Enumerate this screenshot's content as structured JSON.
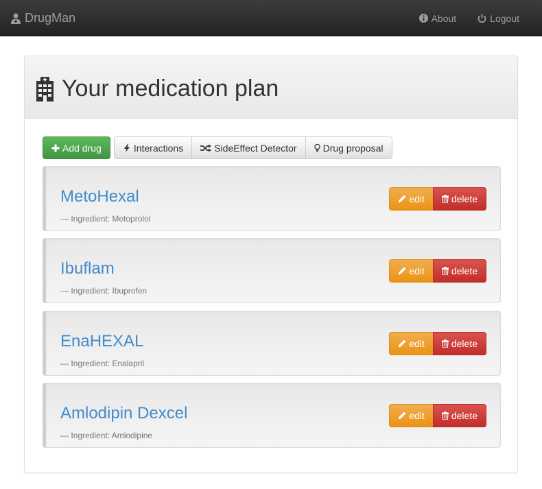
{
  "navbar": {
    "brand": "DrugMan",
    "brand_icon": "user-md-icon",
    "links": [
      {
        "label": "About",
        "icon": "info-sign-icon"
      },
      {
        "label": "Logout",
        "icon": "off-icon"
      }
    ]
  },
  "panel": {
    "title": "Your medication plan",
    "title_icon": "hospital-icon"
  },
  "toolbar": {
    "add_label": "Add drug",
    "interactions_label": "Interactions",
    "sideeffect_label": "SideEffect Detector",
    "proposal_label": "Drug proposal"
  },
  "drugs": [
    {
      "name": "MetoHexal",
      "ingredient": "— Ingredient: Metoprolol"
    },
    {
      "name": "Ibuflam",
      "ingredient": "— Ingredient: Ibuprofen"
    },
    {
      "name": "EnaHEXAL",
      "ingredient": "— Ingredient: Enalapril"
    },
    {
      "name": "Amlodipin Dexcel",
      "ingredient": "— Ingredient: Amlodipine"
    }
  ],
  "actions": {
    "edit_label": "edit",
    "delete_label": "delete"
  },
  "colors": {
    "success": "#5cb85c",
    "warning": "#f0ad4e",
    "danger": "#d9534f",
    "link": "#428bca",
    "navbar": "#222222"
  }
}
